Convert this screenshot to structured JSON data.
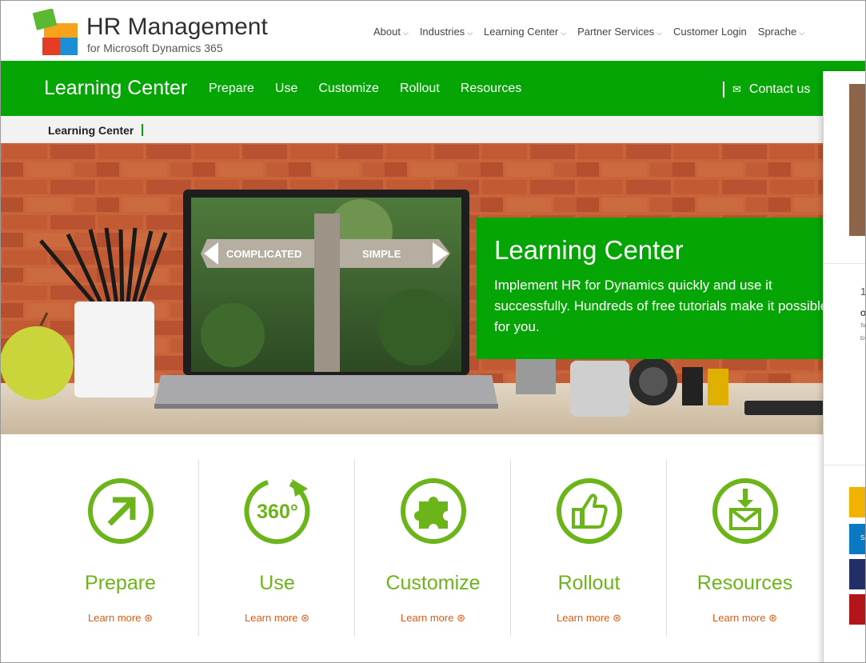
{
  "brand": {
    "title": "HR Management",
    "subtitle": "for Microsoft Dynamics 365"
  },
  "top_nav": [
    {
      "label": "About",
      "has_dropdown": true
    },
    {
      "label": "Industries",
      "has_dropdown": true
    },
    {
      "label": "Learning Center",
      "has_dropdown": true
    },
    {
      "label": "Partner Services",
      "has_dropdown": true
    },
    {
      "label": "Customer Login",
      "has_dropdown": false
    },
    {
      "label": "Sprache",
      "has_dropdown": true
    }
  ],
  "section_bar": {
    "title": "Learning Center",
    "items": [
      "Prepare",
      "Use",
      "Customize",
      "Rollout",
      "Resources"
    ],
    "contact_label": "Contact us"
  },
  "breadcrumb": {
    "current": "Learning Center"
  },
  "hero": {
    "laptop_sign_left": "COMPLICATED",
    "laptop_sign_right": "SIMPLE",
    "title": "Learning Center",
    "text": "Implement HR for Dynamics quickly and use it successfully. Hundreds of free tutorials make it possible for you."
  },
  "features": [
    {
      "name": "Prepare",
      "link": "Learn more",
      "icon": "arrow-up-right-icon"
    },
    {
      "name": "Use",
      "link": "Learn more",
      "icon": "360-icon",
      "icon_text": "360°"
    },
    {
      "name": "Customize",
      "link": "Learn more",
      "icon": "puzzle-icon"
    },
    {
      "name": "Rollout",
      "link": "Learn more",
      "icon": "thumbs-up-icon"
    },
    {
      "name": "Resources",
      "link": "Learn more",
      "icon": "mail-download-icon"
    }
  ],
  "side_panel": {
    "number": "1",
    "label_o": "O",
    "tiny_1": "To",
    "tiny_2": "Er",
    "blue_tile_text": "Sa"
  },
  "colors": {
    "green": "#05a505",
    "icon_green": "#6bb51a",
    "link_orange": "#e05b14",
    "tile_yellow": "#f2b200",
    "tile_blue": "#0a78c2",
    "tile_navy": "#232e66",
    "tile_red": "#b0161a"
  }
}
